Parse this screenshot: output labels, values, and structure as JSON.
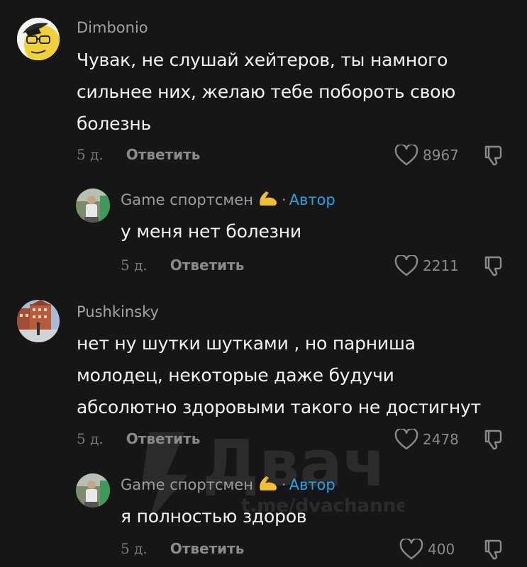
{
  "comments": [
    {
      "username": "Dimbonio",
      "text_lines": [
        "Чувак, не слушай хейтеров, ты намного",
        "сильнее них, желаю тебе побороть свою",
        "болезнь"
      ],
      "time": "5 д.",
      "reply_label": "Ответить",
      "likes": "8967"
    },
    {
      "username": "Game спортсмен",
      "badge": "Автор",
      "dot": "·",
      "text_lines": [
        "у меня нет болезни"
      ],
      "time": "5 д.",
      "reply_label": "Ответить",
      "likes": "2211"
    },
    {
      "username": "Pushkinsky",
      "text_lines": [
        "нет ну шутки шутками , но парниша",
        "молодец, некоторые даже будучи",
        "абсолютно здоровыми такого не достигнут"
      ],
      "time": "5 д.",
      "reply_label": "Ответить",
      "likes": "2478"
    },
    {
      "username": "Game спортсмен",
      "badge": "Автор",
      "dot": "·",
      "text_lines": [
        "я полностью здоров"
      ],
      "time": "5 д.",
      "reply_label": "Ответить",
      "likes": "400"
    }
  ],
  "watermark": {
    "title": "Двач",
    "url": "t.me/dvachannel"
  },
  "colors": {
    "background": "#161616",
    "author_badge": "#25a3e6",
    "secondary_text": "#8a8a8a"
  },
  "icons": [
    "heart-icon",
    "thumb-down-icon",
    "flexed-biceps-emoji"
  ]
}
